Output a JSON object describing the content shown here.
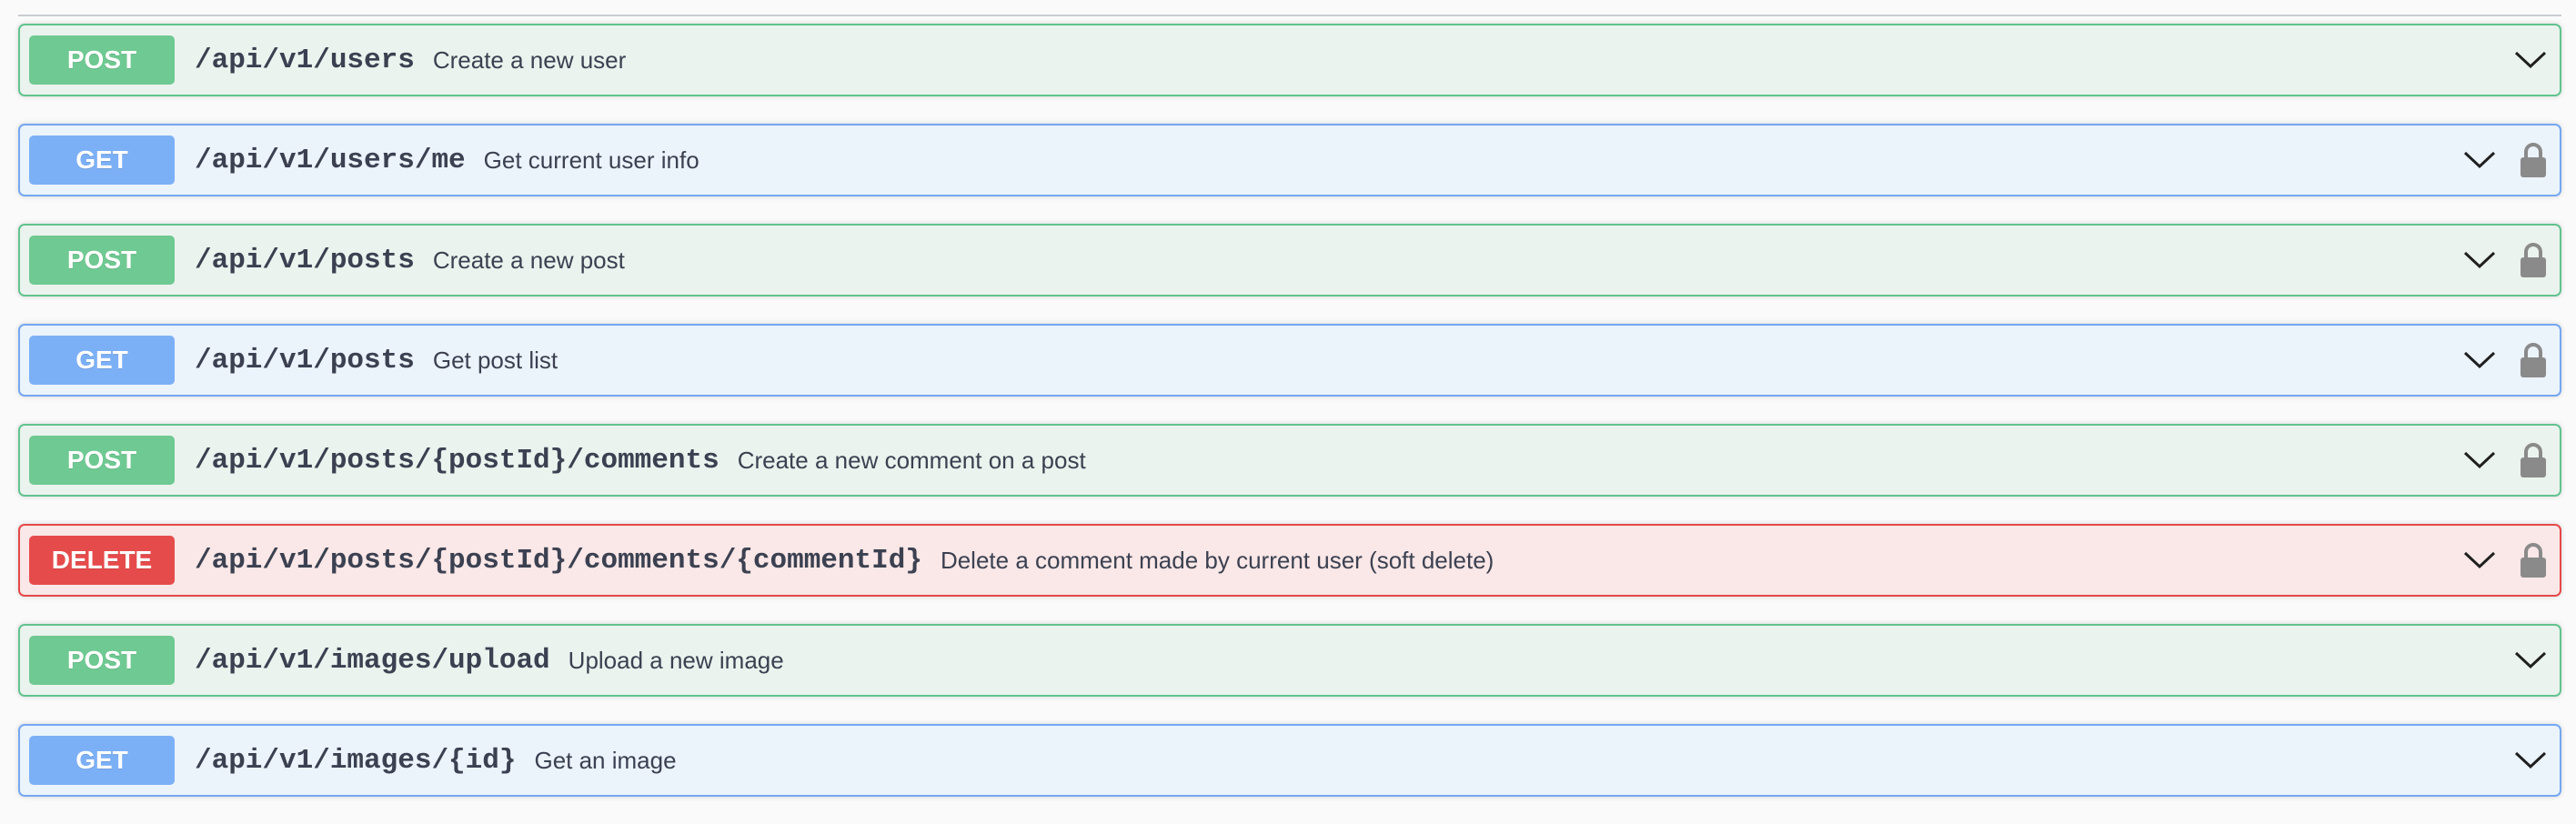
{
  "operations": [
    {
      "method": "POST",
      "path": "/api/v1/users",
      "summary": "Create a new user",
      "locked": false,
      "expand_icon": "chevron-down-icon"
    },
    {
      "method": "GET",
      "path": "/api/v1/users/me",
      "summary": "Get current user info",
      "locked": true,
      "expand_icon": "chevron-down-icon",
      "lock_icon": "lock-icon"
    },
    {
      "method": "POST",
      "path": "/api/v1/posts",
      "summary": "Create a new post",
      "locked": true,
      "expand_icon": "chevron-down-icon",
      "lock_icon": "lock-icon"
    },
    {
      "method": "GET",
      "path": "/api/v1/posts",
      "summary": "Get post list",
      "locked": true,
      "expand_icon": "chevron-down-icon",
      "lock_icon": "lock-icon"
    },
    {
      "method": "POST",
      "path": "/api/v1/posts/{postId}/comments",
      "summary": "Create a new comment on a post",
      "locked": true,
      "expand_icon": "chevron-down-icon",
      "lock_icon": "lock-icon"
    },
    {
      "method": "DELETE",
      "path": "/api/v1/posts/{postId}/comments/{commentId}",
      "summary": "Delete a comment made by current user (soft delete)",
      "locked": true,
      "expand_icon": "chevron-down-icon",
      "lock_icon": "lock-icon"
    },
    {
      "method": "POST",
      "path": "/api/v1/images/upload",
      "summary": "Upload a new image",
      "locked": false,
      "expand_icon": "chevron-down-icon"
    },
    {
      "method": "GET",
      "path": "/api/v1/images/{id}",
      "summary": "Get an image",
      "locked": false,
      "expand_icon": "chevron-down-icon"
    }
  ],
  "colors": {
    "post": "#62c38f",
    "get": "#75a7f0",
    "delete": "#e54848",
    "text": "#3b4151",
    "lock": "#8a8a8a"
  }
}
